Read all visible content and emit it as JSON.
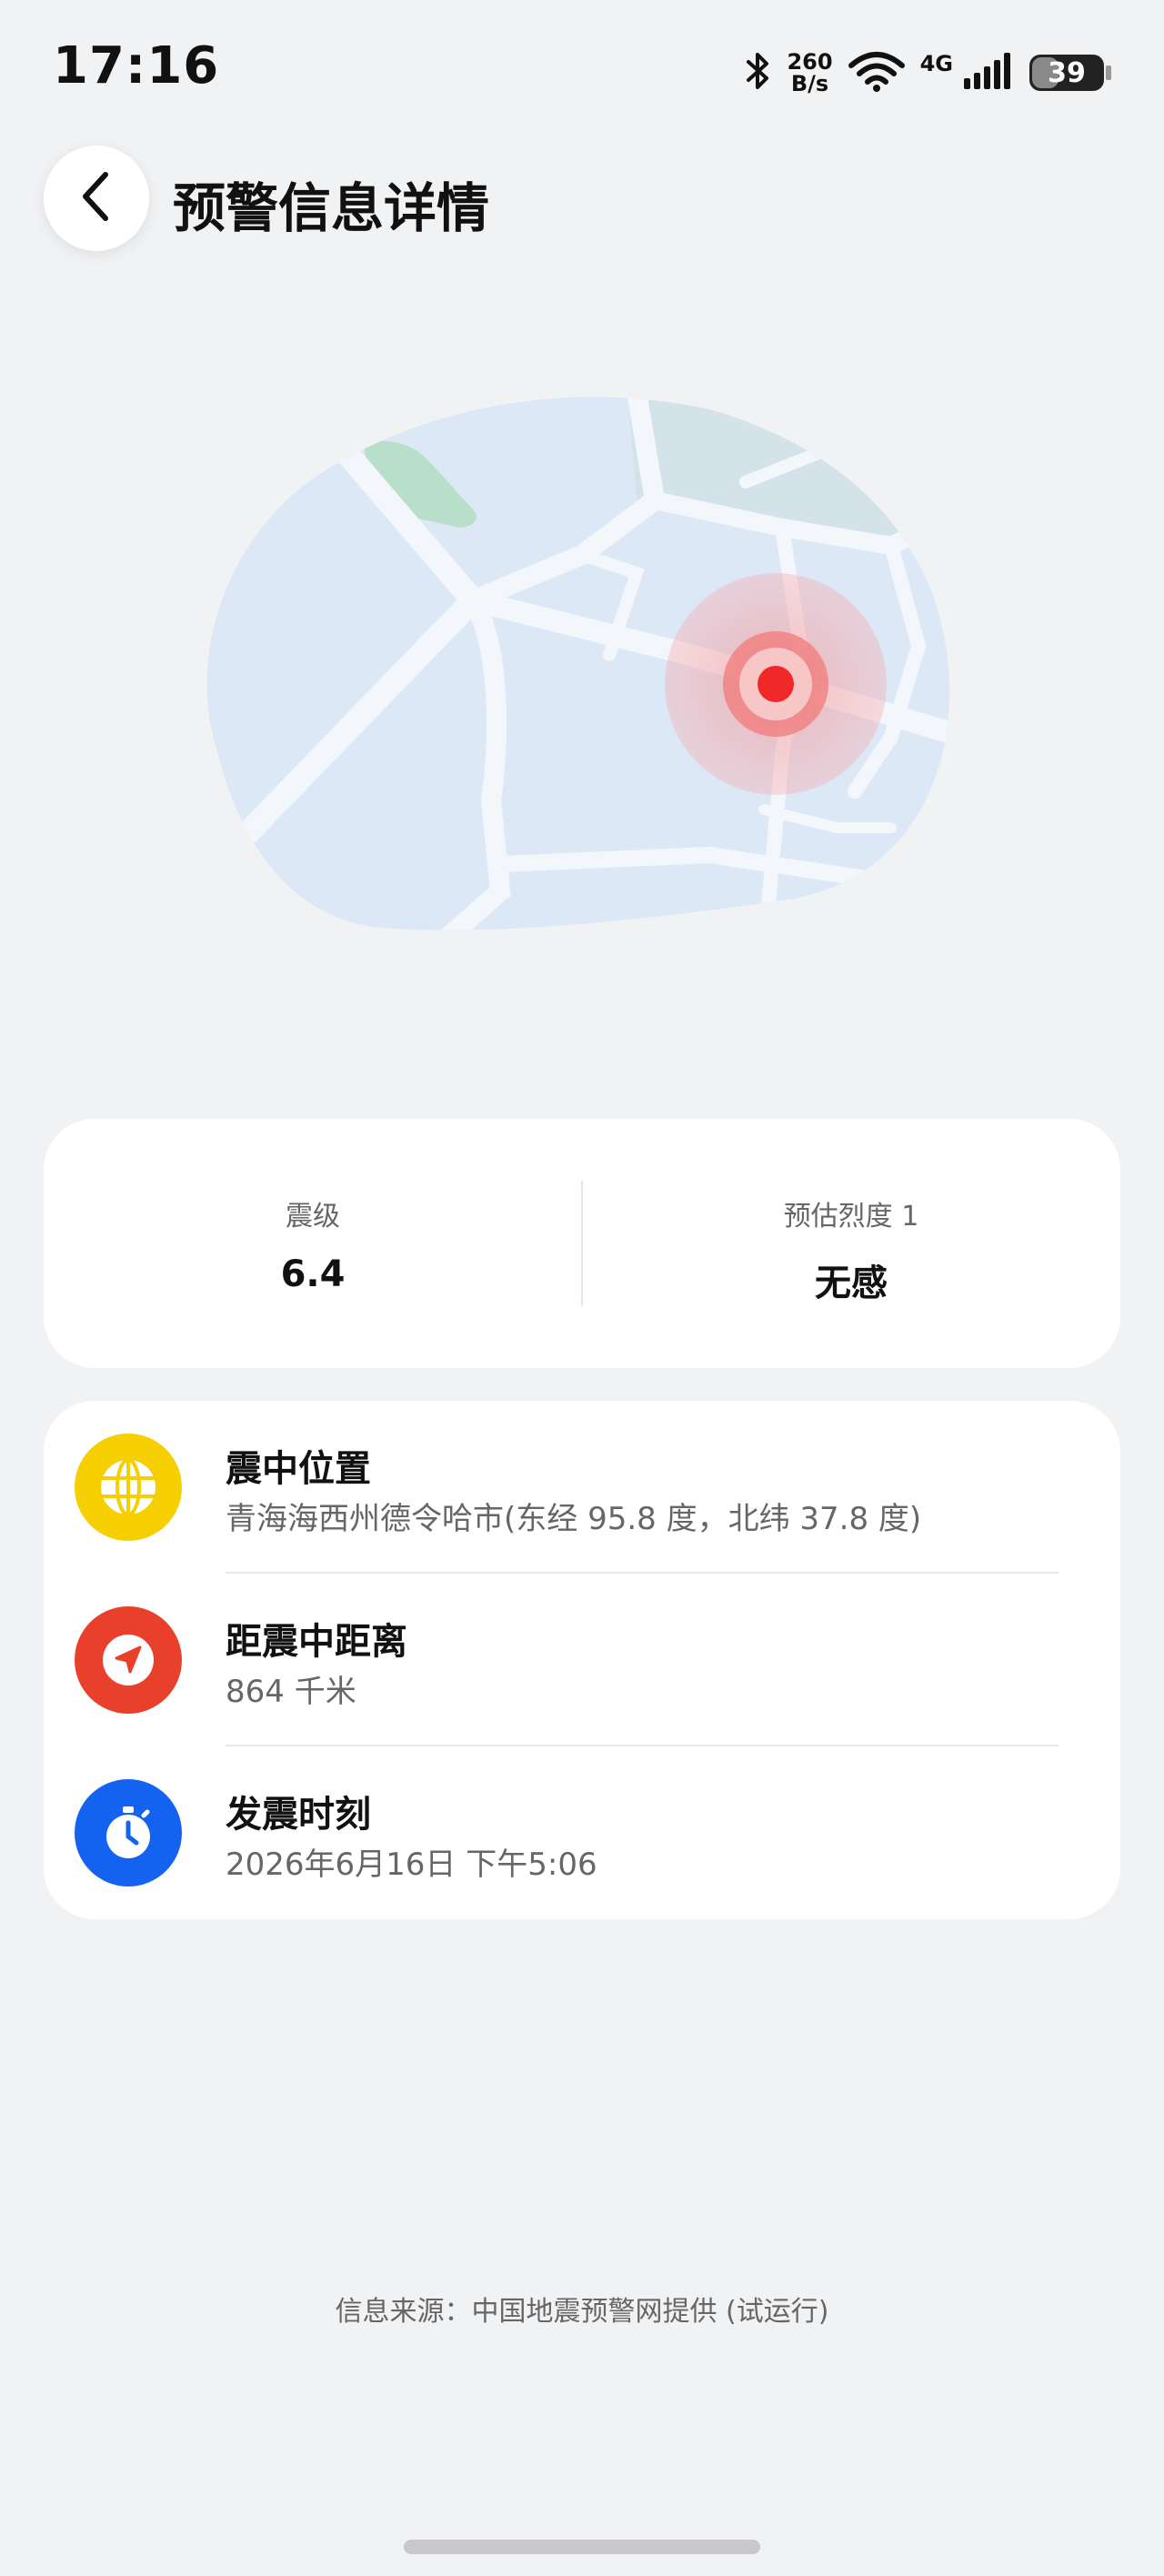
{
  "status_bar": {
    "time": "17:16",
    "net_speed_value": "260",
    "net_speed_unit": "B/s",
    "network": "4G",
    "battery": "39",
    "battery_level_percent": 39,
    "icons": [
      "bluetooth-icon",
      "wifi-icon",
      "signal-icon",
      "battery-icon"
    ]
  },
  "header": {
    "title": "预警信息详情",
    "back_icon": "chevron-left-icon"
  },
  "magnitude": {
    "label": "震级",
    "value": "6.4",
    "intensity_label": "预估烈度 1",
    "intensity_value": "无感"
  },
  "info_rows": [
    {
      "icon": "globe-icon",
      "icon_color": "#f5cf00",
      "title": "震中位置",
      "detail": "青海海西州德令哈市(东经 95.8 度，北纬 37.8 度)"
    },
    {
      "icon": "navigation-arrow-icon",
      "icon_color": "#e8402a",
      "title": "距震中距离",
      "detail": "864 千米"
    },
    {
      "icon": "stopwatch-icon",
      "icon_color": "#1463f0",
      "title": "发震时刻",
      "detail": "2026年6月16日 下午5:06"
    }
  ],
  "footer": {
    "source": "信息来源：中国地震预警网提供 (试运行)"
  },
  "colors": {
    "background": "#f1f2f4",
    "card": "#ffffff",
    "map_land": "#dde8f7",
    "epicenter": "#f02828"
  }
}
